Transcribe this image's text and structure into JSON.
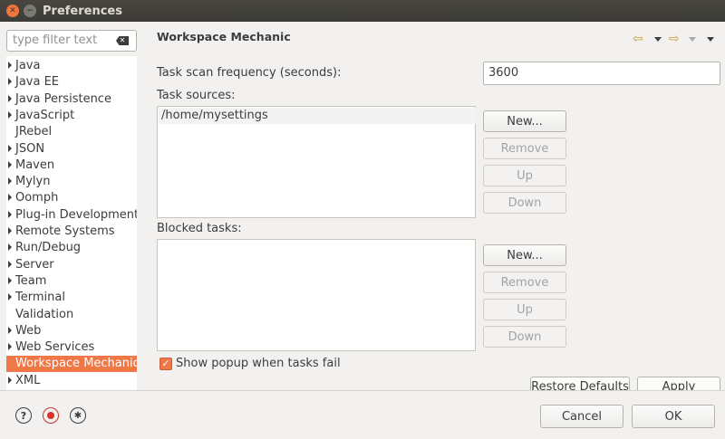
{
  "window": {
    "title": "Preferences"
  },
  "sidebar": {
    "filter_placeholder": "type filter text",
    "items": [
      {
        "label": "Java",
        "expandable": true
      },
      {
        "label": "Java EE",
        "expandable": true
      },
      {
        "label": "Java Persistence",
        "expandable": true
      },
      {
        "label": "JavaScript",
        "expandable": true
      },
      {
        "label": "JRebel",
        "expandable": false
      },
      {
        "label": "JSON",
        "expandable": true
      },
      {
        "label": "Maven",
        "expandable": true
      },
      {
        "label": "Mylyn",
        "expandable": true
      },
      {
        "label": "Oomph",
        "expandable": true
      },
      {
        "label": "Plug-in Development",
        "expandable": true
      },
      {
        "label": "Remote Systems",
        "expandable": true
      },
      {
        "label": "Run/Debug",
        "expandable": true
      },
      {
        "label": "Server",
        "expandable": true
      },
      {
        "label": "Team",
        "expandable": true
      },
      {
        "label": "Terminal",
        "expandable": true
      },
      {
        "label": "Validation",
        "expandable": false
      },
      {
        "label": "Web",
        "expandable": true
      },
      {
        "label": "Web Services",
        "expandable": true
      },
      {
        "label": "Workspace Mechanic",
        "expandable": false,
        "selected": true
      },
      {
        "label": "XML",
        "expandable": true
      }
    ]
  },
  "main": {
    "title": "Workspace Mechanic",
    "scan_label": "Task scan frequency (seconds):",
    "scan_value": "3600",
    "sources_label": "Task sources:",
    "sources": [
      "/home/mysettings"
    ],
    "blocked_label": "Blocked tasks:",
    "buttons": {
      "new": "New...",
      "remove": "Remove",
      "up": "Up",
      "down": "Down"
    },
    "popup_checkbox_label": "Show popup when tasks fail",
    "popup_checked": true,
    "restore_defaults": "Restore Defaults",
    "apply": "Apply"
  },
  "footer": {
    "cancel": "Cancel",
    "ok": "OK"
  },
  "colors": {
    "accent": "#f07746",
    "titlebar": "#3c3b37",
    "nav_arrow": "#c9a23a"
  },
  "icons": {
    "help": "help-icon",
    "record": "record-icon",
    "tip": "lightbulb-icon",
    "clear": "clear-filter-icon"
  }
}
